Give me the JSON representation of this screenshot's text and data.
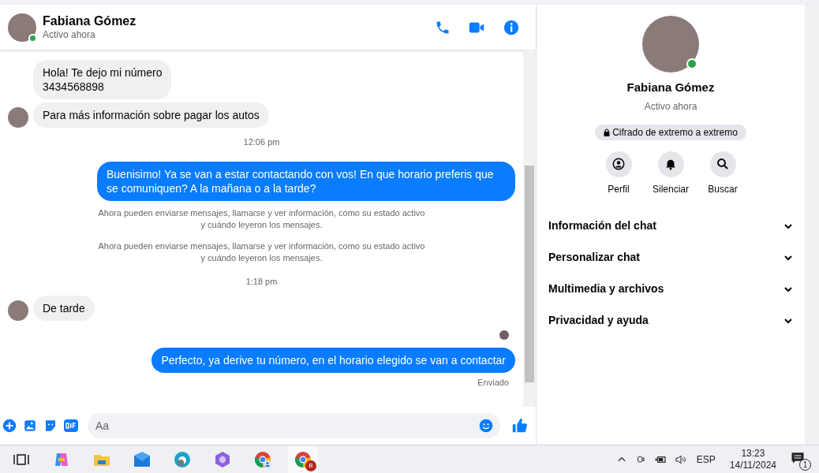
{
  "header": {
    "name": "Fabiana Gómez",
    "status": "Activo ahora",
    "online": true
  },
  "messages": [
    {
      "kind": "incoming",
      "text": "Hola! Te dejo mi número\n3434568898",
      "avatar": false
    },
    {
      "kind": "incoming",
      "text": "Para más información sobre pagar los autos",
      "avatar": true
    },
    {
      "kind": "time",
      "text": "12:06 pm"
    },
    {
      "kind": "outgoing",
      "text": "Buenisimo! Ya se van a estar contactando con vos! En que horario preferis que se comuniquen? A la mañana o a la tarde?"
    },
    {
      "kind": "system",
      "text": "Ahora pueden enviarse mensajes, llamarse y ver información, como su estado activo\ny cuándo leyeron los mensajes."
    },
    {
      "kind": "system",
      "text": "Ahora pueden enviarse mensajes, llamarse y ver información, como su estado activo\ny cuándo leyeron los mensajes."
    },
    {
      "kind": "time",
      "text": "1:18 pm"
    },
    {
      "kind": "incoming",
      "text": "De tarde",
      "avatar": true
    },
    {
      "kind": "seen"
    },
    {
      "kind": "outgoing",
      "text": "Perfecto, ya derive tu número,  en el horario elegido se van a contactar"
    },
    {
      "kind": "delivery",
      "text": "Enviado"
    }
  ],
  "composer": {
    "placeholder": "Aa"
  },
  "profile": {
    "name": "Fabiana Gómez",
    "status": "Activo ahora",
    "online": true,
    "encryption": "Cifrado de extremo a extremo",
    "actions": [
      {
        "kind": "profile",
        "label": "Perfil"
      },
      {
        "kind": "mute",
        "label": "Silenciar"
      },
      {
        "kind": "search",
        "label": "Buscar"
      }
    ],
    "sections": [
      {
        "label": "Información del chat",
        "expanded": false
      },
      {
        "label": "Personalizar chat",
        "expanded": false
      },
      {
        "label": "Multimedia y archivos",
        "expanded": false
      },
      {
        "label": "Privacidad y ayuda",
        "expanded": false
      }
    ]
  },
  "taskbar": {
    "apps": [
      {
        "kind": "taskview"
      },
      {
        "kind": "copilot"
      },
      {
        "kind": "files"
      },
      {
        "kind": "mail"
      },
      {
        "kind": "edge"
      },
      {
        "kind": "m365"
      },
      {
        "kind": "chrome-profile"
      },
      {
        "kind": "chrome-b",
        "badge": "B"
      }
    ],
    "language": "ESP",
    "time": "13:23",
    "date": "14/11/2024",
    "notifications": "1"
  }
}
